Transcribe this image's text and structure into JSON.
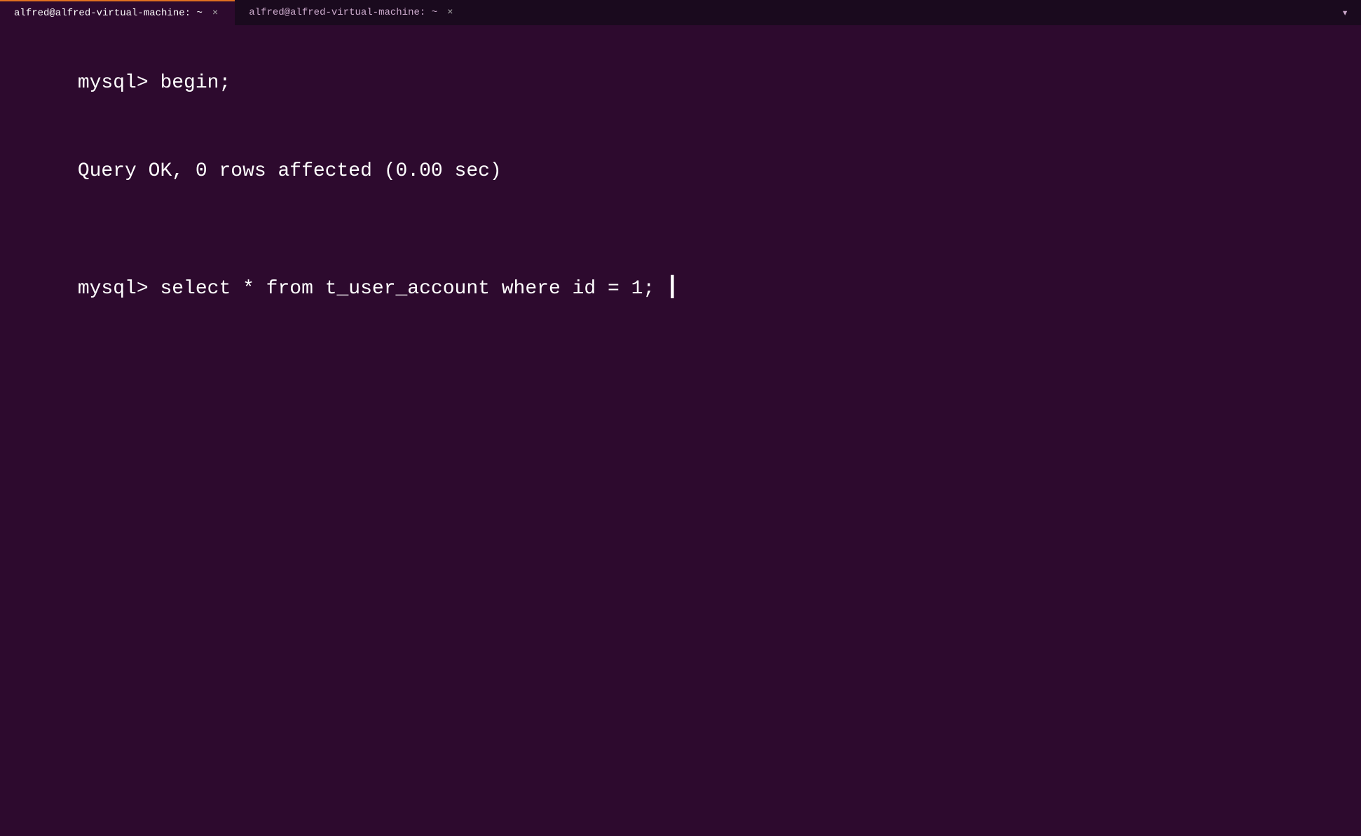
{
  "tabs": [
    {
      "id": "tab1",
      "title": "alfred@alfred-virtual-machine: ~",
      "active": true,
      "close_label": "×"
    },
    {
      "id": "tab2",
      "title": "alfred@alfred-virtual-machine: ~",
      "active": false,
      "close_label": "×"
    }
  ],
  "tab_dropdown_icon": "▾",
  "terminal": {
    "lines": [
      {
        "type": "prompt_cmd",
        "prompt": "mysql> ",
        "command": "begin;"
      },
      {
        "type": "output",
        "text": "Query OK, 0 rows affected (0.00 sec)"
      },
      {
        "type": "blank"
      },
      {
        "type": "prompt_cmd",
        "prompt": "mysql> ",
        "command": "select * from t_user_account where id = 1;"
      }
    ]
  }
}
